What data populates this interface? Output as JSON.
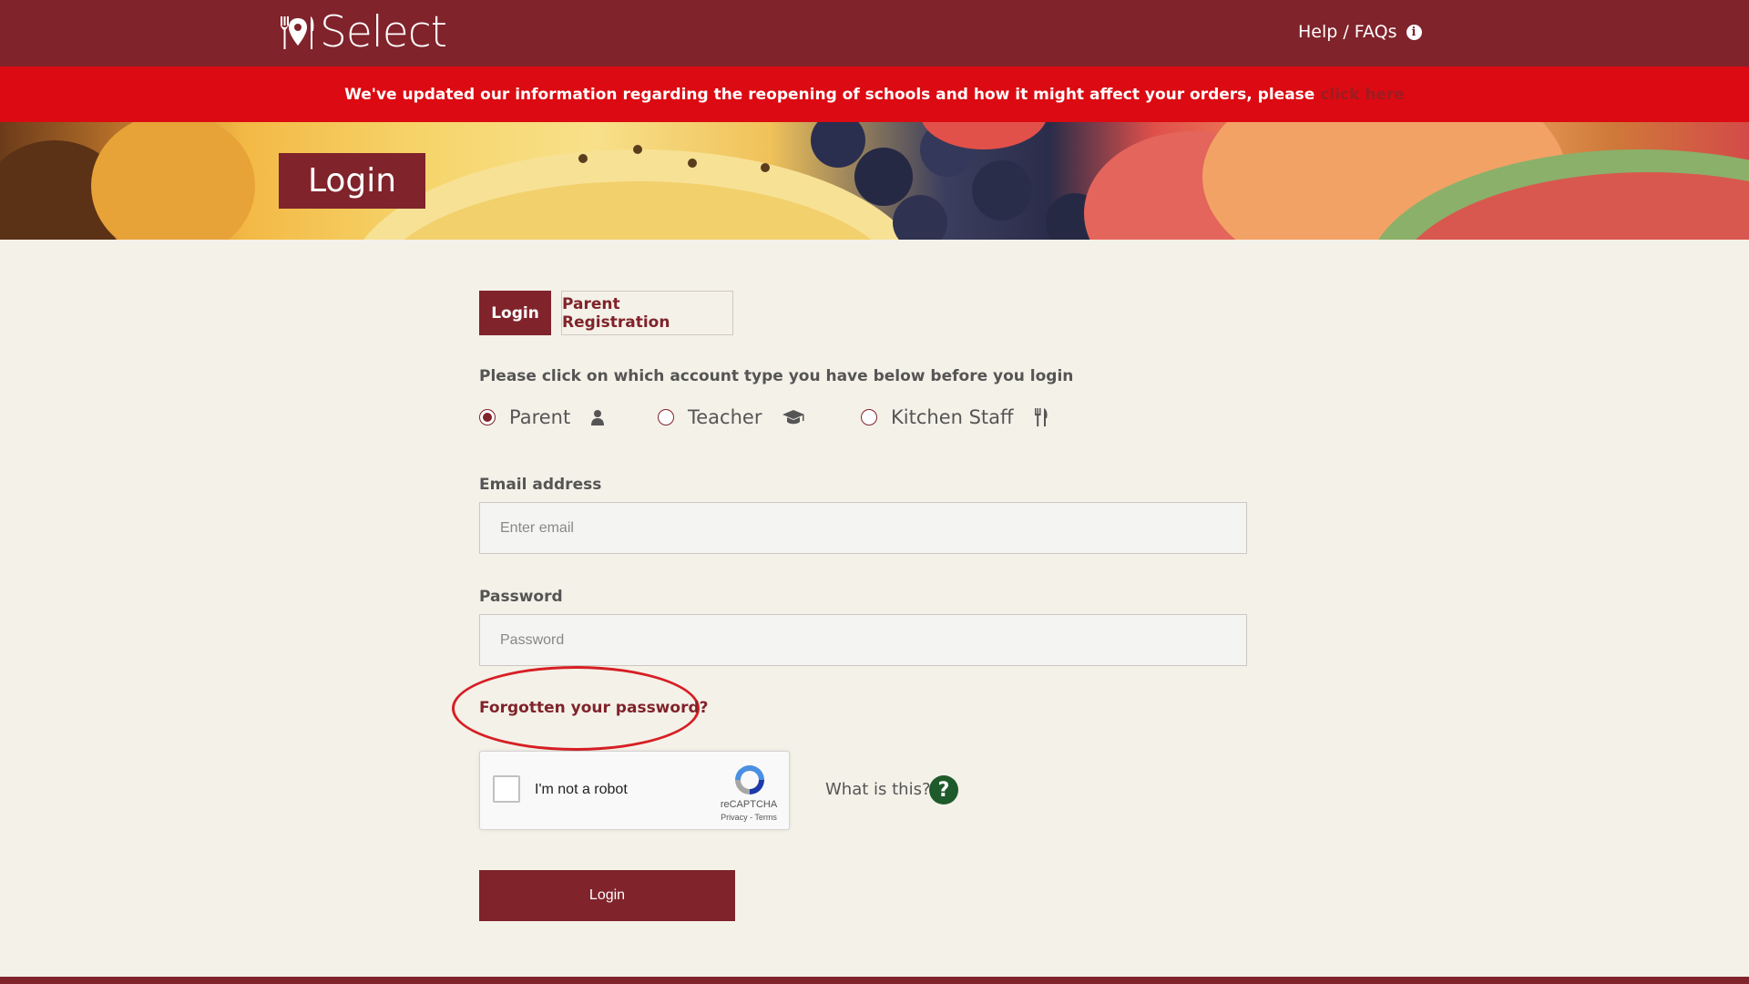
{
  "header": {
    "logo_text": "Select",
    "help_label": "Help / FAQs",
    "info_icon_glyph": "i"
  },
  "alert": {
    "message": "We've updated our information regarding the reopening of schools and how it might affect your orders, please",
    "link_text": "click here"
  },
  "hero": {
    "title": "Login"
  },
  "tabs": [
    {
      "label": "Login",
      "active": true
    },
    {
      "label": "Parent Registration",
      "active": false
    }
  ],
  "account_type": {
    "instruction": "Please click on which account type you have below before you login",
    "options": [
      {
        "label": "Parent",
        "icon": "user-icon",
        "selected": true
      },
      {
        "label": "Teacher",
        "icon": "graduation-cap-icon",
        "selected": false
      },
      {
        "label": "Kitchen Staff",
        "icon": "utensils-icon",
        "selected": false
      }
    ]
  },
  "form": {
    "email_label": "Email address",
    "email_placeholder": "Enter email",
    "password_label": "Password",
    "password_placeholder": "Password",
    "forgot_link": "Forgotten your password?",
    "submit_label": "Login"
  },
  "captcha": {
    "label": "I'm not a robot",
    "brand": "reCAPTCHA",
    "links": "Privacy - Terms",
    "what_is_this": "What is this?",
    "help_glyph": "?"
  },
  "colors": {
    "brand": "#80232b",
    "alert": "#dc0a12",
    "background": "#f4f1e8",
    "annotation": "#d61f25",
    "help_green": "#1e5a2a"
  }
}
